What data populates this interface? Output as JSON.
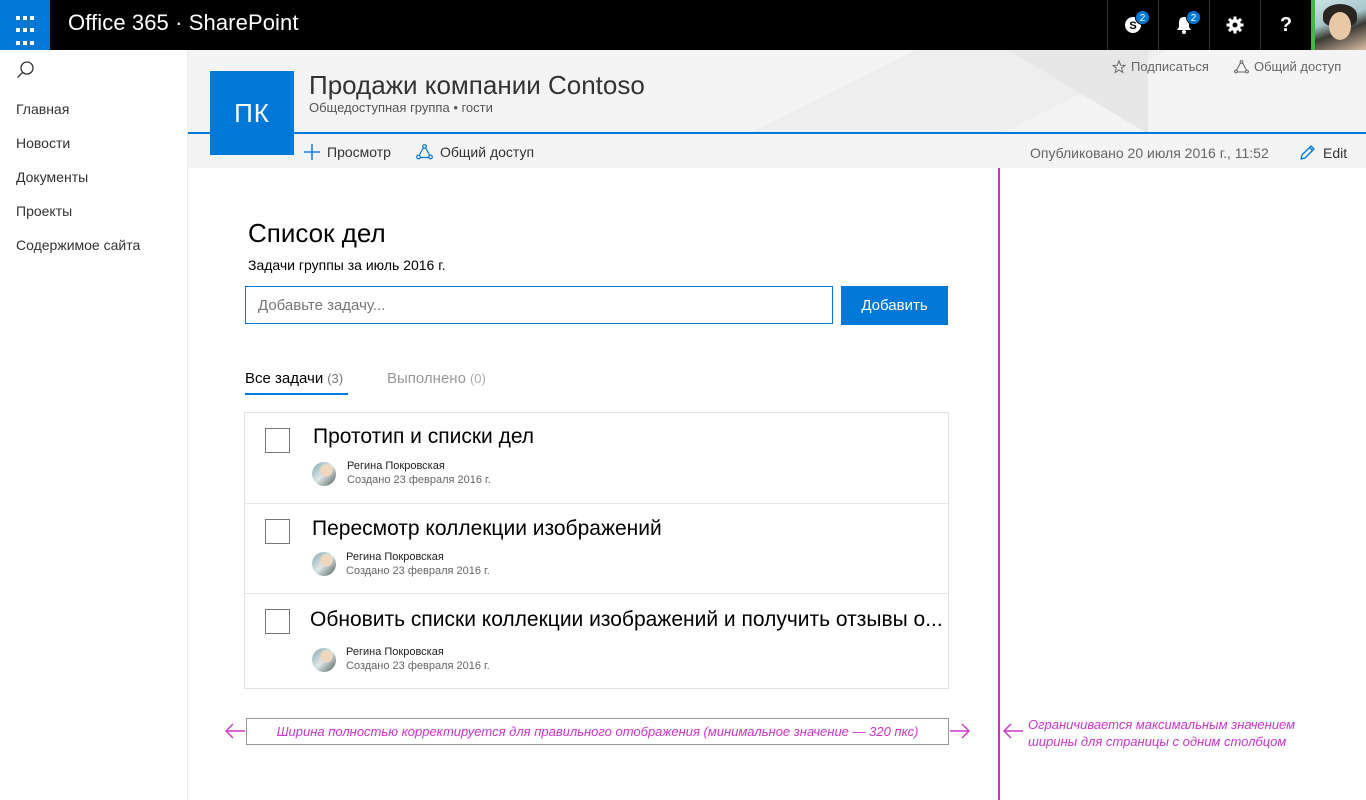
{
  "suitebar": {
    "brand": "Office 365 · SharePoint",
    "skype_badge": "2",
    "notifications_badge": "2",
    "help_label": "?"
  },
  "leftnav": {
    "items": [
      {
        "label": "Главная"
      },
      {
        "label": "Новости"
      },
      {
        "label": "Документы"
      },
      {
        "label": "Проекты"
      },
      {
        "label": "Содержимое сайта"
      }
    ]
  },
  "header": {
    "logo_initials": "ПК",
    "title": "Продажи компании Contoso",
    "subtitle": "Общедоступная группа • гости",
    "follow_label": "Подписаться",
    "share_label": "Общий доступ"
  },
  "commandbar": {
    "view_label": "Просмотр",
    "share_label": "Общий доступ",
    "published": "Опубликовано 20 июля 2016 г., 11:52",
    "edit_label": "Edit"
  },
  "todo": {
    "title": "Список дел",
    "subtitle": "Задачи группы за июль 2016 г.",
    "input_placeholder": "Добавьте задачу...",
    "add_button": "Добавить",
    "tabs": [
      {
        "label": "Все задачи",
        "count": "(3)",
        "active": true
      },
      {
        "label": "Выполнено",
        "count": "(0)",
        "active": false
      }
    ],
    "tasks": [
      {
        "title": "Прототип и списки дел",
        "author": "Регина Покровская",
        "created": "Создано 23 февраля 2016 г."
      },
      {
        "title": "Пересмотр коллекции изображений",
        "author": "Регина Покровская",
        "created": "Создано 23 февраля 2016 г."
      },
      {
        "title": "Обновить списки коллекции изображений и получить отзывы о...",
        "author": "Регина Покровская",
        "created": "Создано 23 февраля 2016 г."
      }
    ]
  },
  "annotations": {
    "width_note": "Ширина полностью корректируется для правильного отображения (минимальное значение — 320 пкс)",
    "max_note_line1": "Ограничивается максимальным значением",
    "max_note_line2": "ширины для страницы с одним столбцом"
  },
  "colors": {
    "accent": "#0078d7",
    "annotation": "#cc33cc",
    "suitebar": "#000000"
  }
}
